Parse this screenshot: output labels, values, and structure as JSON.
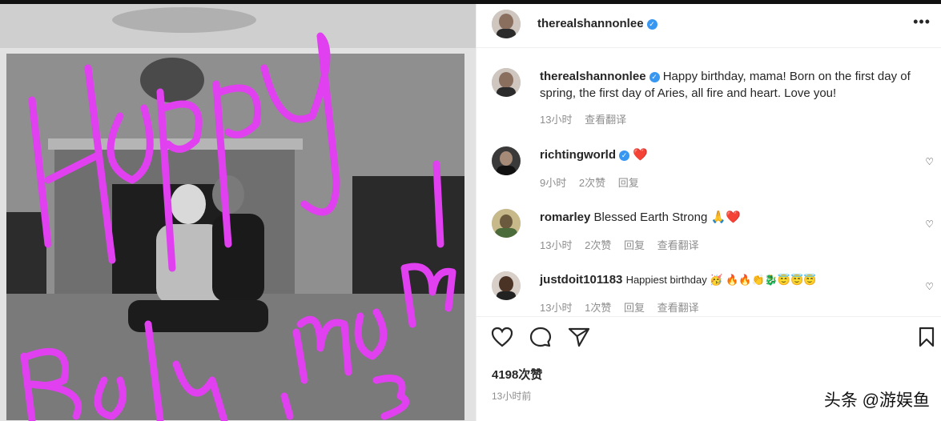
{
  "post": {
    "author": "therealshannonlee",
    "caption": "Happy birthday, mama! Born on the first day of spring, the first day of Aries, all fire and heart. Love you!",
    "caption_time": "13小时",
    "caption_translate": "查看翻译",
    "likes": "4198次赞",
    "posted_ago": "13小时前",
    "photo_overlay_text": [
      "Happy",
      "Bday",
      "mom"
    ]
  },
  "comments": [
    {
      "user": "richtingworld",
      "verified": true,
      "text": "❤️",
      "time": "9小时",
      "likes": "2次赞",
      "reply": "回复",
      "translate": ""
    },
    {
      "user": "romarley",
      "verified": false,
      "text": "Blessed Earth Strong 🙏❤️",
      "time": "13小时",
      "likes": "2次赞",
      "reply": "回复",
      "translate": "查看翻译"
    },
    {
      "user": "justdoit101183",
      "verified": false,
      "text": "Happiest birthday 🥳 🔥🔥👏🐉😇😇😇",
      "time": "13小时",
      "likes": "1次赞",
      "reply": "回复",
      "translate": "查看翻译"
    }
  ],
  "watermark": "头条 @游娱鱼",
  "icons": {
    "more": "more-horizontal-icon",
    "like": "heart-outline-icon",
    "comment": "comment-bubble-icon",
    "share": "paper-plane-icon",
    "save": "bookmark-icon"
  },
  "colors": {
    "verified": "#3897f0",
    "overlay_ink": "#e040f0",
    "meta_text": "#8e8e8e"
  }
}
